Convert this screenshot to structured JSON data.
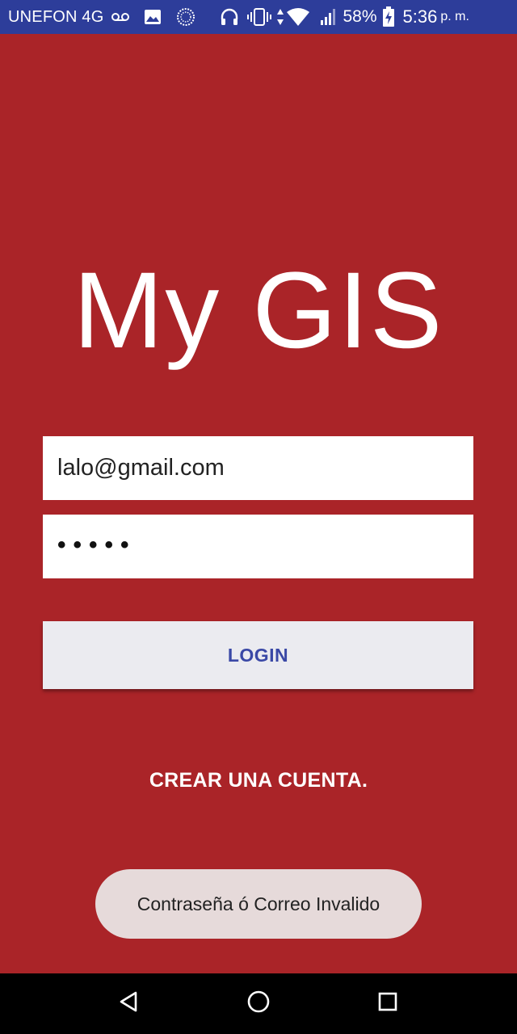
{
  "status_bar": {
    "carrier": "UNEFON 4G",
    "battery_percent": "58%",
    "time": "5:36",
    "time_suffix": "p. m.",
    "icons": [
      "voicemail-icon",
      "image-icon",
      "sync-icon",
      "headphones-icon",
      "vibrate-icon",
      "data-arrows-icon",
      "wifi-icon",
      "signal-icon",
      "battery-icon"
    ]
  },
  "app": {
    "title": "My GIS"
  },
  "login_form": {
    "email_value": "lalo@gmail.com",
    "password_masked": "•••••",
    "login_button_label": "LOGIN",
    "create_account_label": "CREAR UNA CUENTA."
  },
  "toast": {
    "message": "Contraseña ó Correo Invalido"
  },
  "nav_bar": {
    "buttons": [
      "back-icon",
      "home-icon",
      "recents-icon"
    ]
  },
  "colors": {
    "background": "#aa2428",
    "status_bar": "#2d3d9a",
    "button_bg": "#ebebf0",
    "button_text": "#3a48a6",
    "toast_bg": "#e6dada"
  }
}
